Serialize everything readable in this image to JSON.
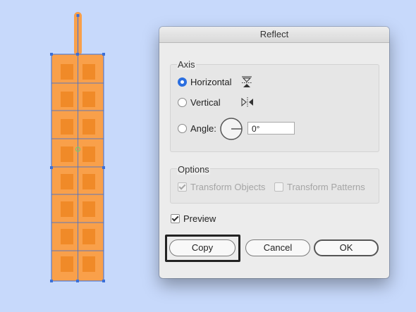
{
  "dialog": {
    "title": "Reflect",
    "axis": {
      "label": "Axis",
      "horizontal_label": "Horizontal",
      "vertical_label": "Vertical",
      "angle_label": "Angle:",
      "angle_value": "0°",
      "selected": "Horizontal"
    },
    "options": {
      "label": "Options",
      "transform_objects_label": "Transform Objects",
      "transform_objects_checked": true,
      "transform_patterns_label": "Transform Patterns",
      "transform_patterns_checked": false
    },
    "preview": {
      "label": "Preview",
      "checked": true
    },
    "buttons": {
      "copy": "Copy",
      "cancel": "Cancel",
      "ok": "OK"
    }
  },
  "colors": {
    "canvas_background": "#c7d9fb",
    "artwork_fill": "#f9a04a",
    "artwork_tile": "#f08a28",
    "selection_blue": "#3b6fd8",
    "accent_radio": "#2b6fe0"
  },
  "icons": {
    "horizontal_axis": "flip-horizontal-icon",
    "vertical_axis": "flip-vertical-icon",
    "angle": "angle-dial-icon"
  }
}
